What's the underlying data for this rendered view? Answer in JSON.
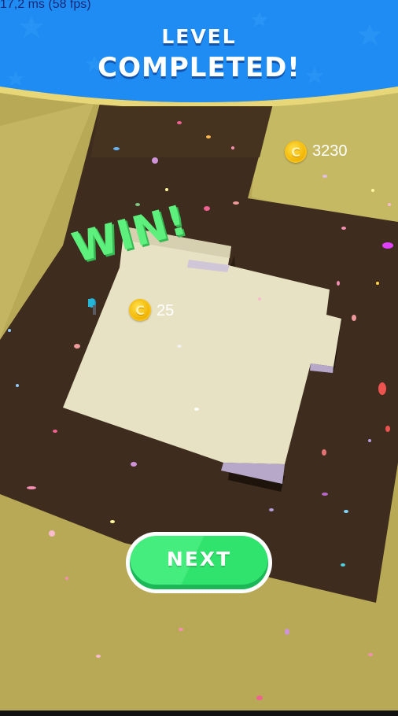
{
  "debug": {
    "frame_time": "17,2 ms (58 fps)"
  },
  "banner": {
    "line1": "LEVEL",
    "line2": "COMPLETED!"
  },
  "coins": {
    "total": "3230",
    "reward": "25",
    "coin_symbol": "C"
  },
  "win_text": "WIN!",
  "next_button": {
    "label": "NEXT"
  },
  "colors": {
    "banner_blue": "#1e8cf2",
    "ground": "#b8a957",
    "dark_floor": "#3e2c1e",
    "painted_floor": "#e8e2c4",
    "win_green": "#5ef07c",
    "next_green": "#45ec7e"
  },
  "icons": [
    "coin-icon",
    "player-character"
  ]
}
